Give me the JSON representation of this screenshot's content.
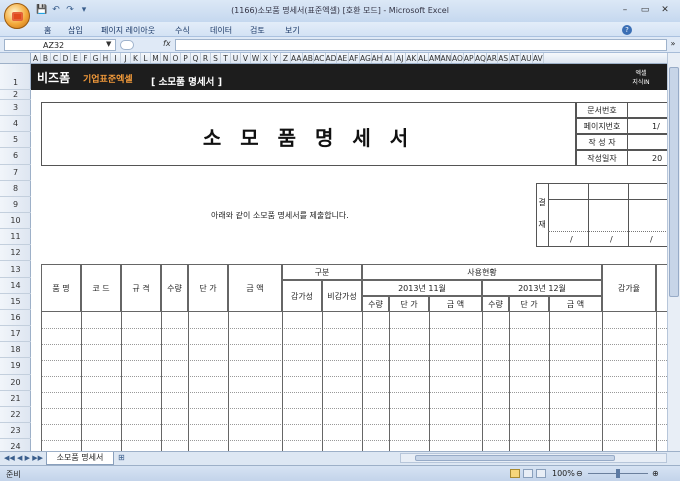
{
  "window": {
    "title": "(1166)소모품 명세서(표준엑셀) [호환 모드] - Microsoft Excel",
    "controls": [
      "–",
      "▭",
      "✕"
    ],
    "quick_access": [
      "💾",
      "↶",
      "↷",
      "▾"
    ]
  },
  "ribbon": {
    "tabs": [
      "홈",
      "삽입",
      "페이지 레이아웃",
      "수식",
      "데이터",
      "검토",
      "보기"
    ],
    "help": "?"
  },
  "formula_bar": {
    "name_box": "AZ32",
    "fx": "fx",
    "value": ""
  },
  "columns": [
    "A",
    "B",
    "C",
    "D",
    "E",
    "F",
    "G",
    "H",
    "I",
    "J",
    "K",
    "L",
    "M",
    "N",
    "O",
    "P",
    "Q",
    "R",
    "S",
    "T",
    "U",
    "V",
    "W",
    "X",
    "Y",
    "Z",
    "AA",
    "AB",
    "AC",
    "AD",
    "AE",
    "AF",
    "AG",
    "AH",
    "AI",
    "AJ",
    "AK",
    "AL",
    "AM",
    "AN",
    "AO",
    "AP",
    "AQ",
    "AR",
    "AS",
    "AT",
    "AU",
    "AV"
  ],
  "rows": [
    "1",
    "2",
    "3",
    "4",
    "5",
    "6",
    "7",
    "8",
    "9",
    "10",
    "11",
    "12",
    "13",
    "14",
    "15",
    "16",
    "17",
    "18",
    "19",
    "20",
    "21",
    "22",
    "23",
    "24"
  ],
  "banner": {
    "logo": "비즈폼",
    "subtitle": "기업표준엑셀",
    "title": "[ 소모품 명세서 ]",
    "right_top": "엑셀",
    "right_bottom": "지식IN"
  },
  "document": {
    "title": "소 모 품 명 세 서",
    "info": [
      {
        "label": "문서번호",
        "value": ""
      },
      {
        "label": "페이지번호",
        "value": "1/"
      },
      {
        "label": "작 성 자",
        "value": ""
      },
      {
        "label": "작성일자",
        "value": "20"
      }
    ],
    "approval_label_1": "결",
    "approval_label_2": "재",
    "approval_slash": "/",
    "submit_text": "아래와 같이 소모품 명세서를 제출합니다."
  },
  "table": {
    "h_item": "품 명",
    "h_code": "코 드",
    "h_spec": "규 격",
    "h_qty": "수량",
    "h_price": "단 가",
    "h_amount": "금 액",
    "h_category": "구분",
    "h_depreciable": "감가성",
    "h_nondepreciable": "비감가성",
    "h_usage": "사용현황",
    "h_month1": "2013년 11월",
    "h_month2": "2013년 12월",
    "h_sub_qty": "수량",
    "h_sub_price": "단 가",
    "h_sub_amount": "금  액",
    "h_depr_rate": "감가율"
  },
  "sheet_tab": "소모품 명세서",
  "status": {
    "ready": "준비",
    "zoom": "100%"
  }
}
